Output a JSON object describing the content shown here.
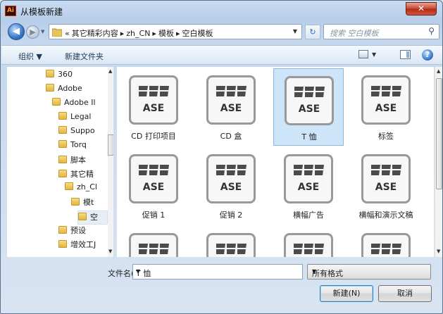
{
  "window": {
    "title": "从模板新建",
    "app_icon_text": "Ai",
    "close_symbol": "✕"
  },
  "address_bar": {
    "crumbs": [
      "«",
      "其它精彩内容",
      "▸",
      "zh_CN",
      "▸",
      "模板",
      "▸",
      "空白模板"
    ],
    "search_placeholder": "搜索 空白模板"
  },
  "command_bar": {
    "organize": "组织 ▼",
    "new_folder": "新建文件夹"
  },
  "tree": [
    {
      "label": "360",
      "indent": 0
    },
    {
      "label": "Adobe",
      "indent": 0
    },
    {
      "label": "Adobe Il",
      "indent": 1
    },
    {
      "label": "Legal",
      "indent": 2
    },
    {
      "label": "Suppo",
      "indent": 2
    },
    {
      "label": "Torq",
      "indent": 2
    },
    {
      "label": "脚本",
      "indent": 2
    },
    {
      "label": "其它精",
      "indent": 2
    },
    {
      "label": "zh_Cl",
      "indent": 3
    },
    {
      "label": "模t",
      "indent": 4
    },
    {
      "label": "空",
      "indent": 5
    },
    {
      "label": "预设",
      "indent": 2
    },
    {
      "label": "增效工J",
      "indent": 2
    }
  ],
  "tiles": [
    {
      "label": "CD 打印项目",
      "selected": false
    },
    {
      "label": "CD 盒",
      "selected": false
    },
    {
      "label": "T 恤",
      "selected": true
    },
    {
      "label": "标签",
      "selected": false
    },
    {
      "label": "促销 1",
      "selected": false
    },
    {
      "label": "促销 2",
      "selected": false
    },
    {
      "label": "横幅广告",
      "selected": false
    },
    {
      "label": "横幅和演示文稿",
      "selected": false
    },
    {
      "label": "",
      "selected": false
    },
    {
      "label": "",
      "selected": false
    },
    {
      "label": "",
      "selected": false
    },
    {
      "label": "",
      "selected": false
    }
  ],
  "tile_icon_text": "ASE",
  "footer": {
    "filename_label": "文件名(N):",
    "filename_value": "T 恤",
    "filetype_value": "所有格式",
    "new_button": "新建(N)",
    "cancel_button": "取消"
  },
  "colors": {
    "selection": "#cde4f9",
    "accent": "#2f6cc0"
  }
}
